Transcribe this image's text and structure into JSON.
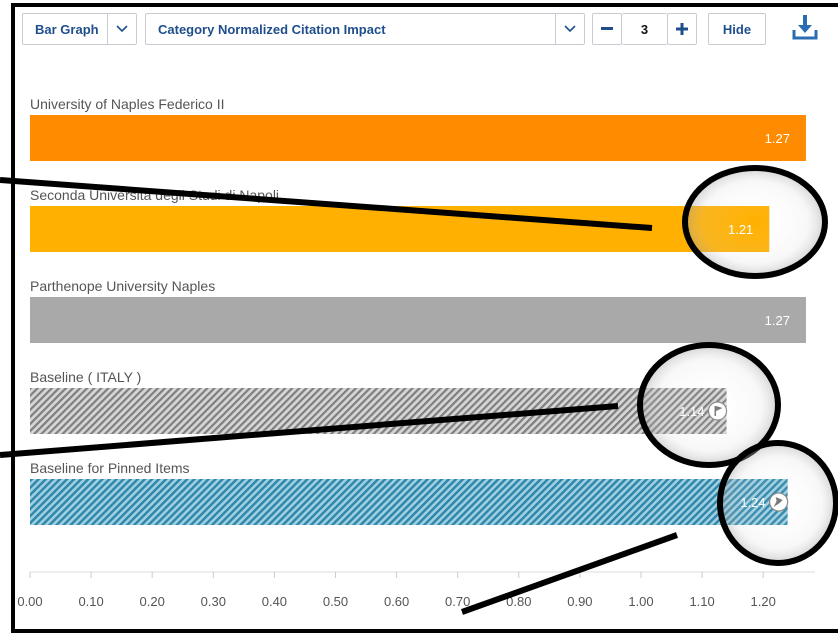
{
  "toolbar": {
    "chart_type": "Bar Graph",
    "metric": "Category Normalized Citation Impact",
    "count": "3",
    "hide_label": "Hide"
  },
  "colors": {
    "orange": "#ff8c00",
    "yellow": "#ffb000",
    "gray": "#a9a9a9",
    "hatch_gray": "#8c8c8c",
    "teal": "#2e8cae",
    "brand": "#1f4e8c"
  },
  "chart_data": {
    "type": "bar",
    "orientation": "horizontal",
    "categories": [
      "University of Naples Federico II",
      "Seconda Universita degli Studi di Napoli",
      "Parthenope University Naples",
      "Baseline ( ITALY )",
      "Baseline for Pinned Items"
    ],
    "values": [
      1.27,
      1.21,
      1.27,
      1.14,
      1.24
    ],
    "value_labels": [
      "1.27",
      "1.21",
      "1.27",
      "1.14",
      "1.24"
    ],
    "ticks": [
      "0.00",
      "0.10",
      "0.20",
      "0.30",
      "0.40",
      "0.50",
      "0.60",
      "0.70",
      "0.80",
      "0.90",
      "1.00",
      "1.10",
      "1.20"
    ],
    "xlim": [
      0,
      1.27
    ],
    "bar_colors": [
      "#ff8c00",
      "#ffb000",
      "#a9a9a9",
      "hatch-gray",
      "hatch-teal"
    ],
    "icons": [
      "",
      "",
      "",
      "flag-icon",
      "pin-icon"
    ]
  }
}
